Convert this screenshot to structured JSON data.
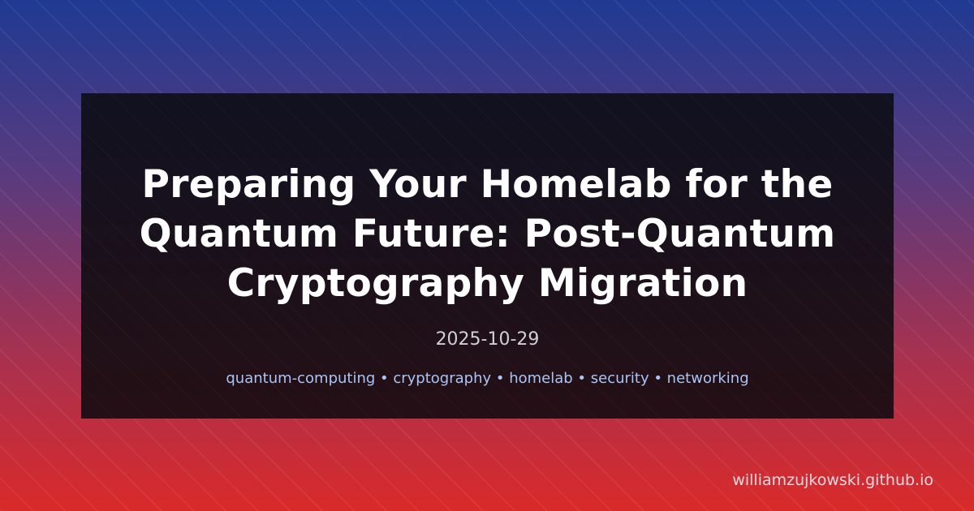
{
  "card": {
    "title": "Preparing Your Homelab for the Quantum Future: Post-Quantum Cryptography Migration",
    "date": "2025-10-29",
    "tags": "quantum-computing • cryptography • homelab • security • networking"
  },
  "footer": {
    "site": "williamzujkowski.github.io"
  },
  "colors": {
    "gradient_top": "#1f3a93",
    "gradient_bottom": "#d92a2a",
    "card_background": "#0a0a0e",
    "title_text": "#ffffff",
    "tag_text": "#a9c4f5"
  }
}
